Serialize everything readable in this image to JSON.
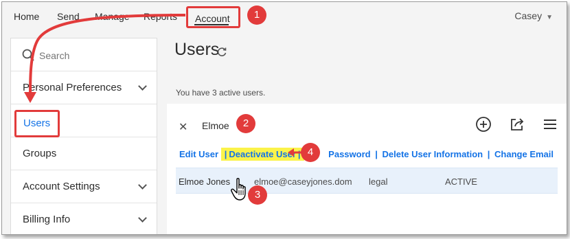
{
  "topnav": {
    "items": [
      "Home",
      "Send",
      "Manage",
      "Reports"
    ],
    "account": "Account",
    "user": "Casey"
  },
  "sidebar": {
    "search_placeholder": "Search",
    "items": [
      {
        "label": "Personal Preferences"
      },
      {
        "label": "Users"
      },
      {
        "label": "Groups"
      },
      {
        "label": "Account Settings"
      },
      {
        "label": "Billing Info"
      }
    ]
  },
  "main": {
    "title": "Users",
    "active_text": "You have 3 active users.",
    "filter_text": "Elmoe",
    "actions": {
      "edit": "Edit User",
      "deactivate": "Deactivate User",
      "reset": "Password",
      "delete": "Delete User Information",
      "change_email": "Change Email",
      "separator": "|"
    },
    "row": {
      "name": "Elmoe Jones",
      "email": "elmoe@caseyjones.dom",
      "group": "legal",
      "status": "ACTIVE"
    }
  },
  "annotations": {
    "badges": [
      "1",
      "2",
      "3",
      "4"
    ],
    "color": "#e23b3b"
  },
  "colors": {
    "link": "#1473e6",
    "highlight": "#fbf34a",
    "selected_row": "#e8f1fb"
  }
}
